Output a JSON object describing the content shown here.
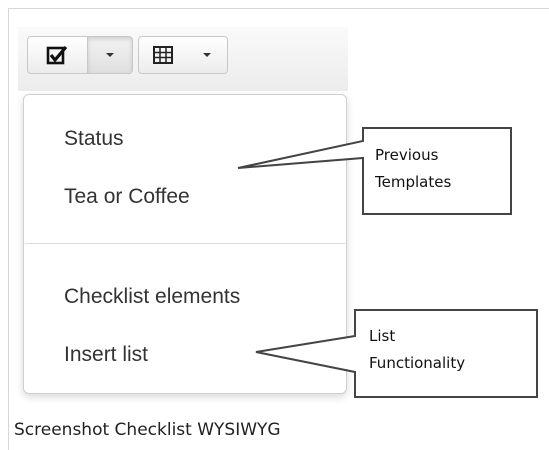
{
  "toolbar": {
    "checklist_button_icon": "checkbox-checked-icon",
    "table_button_icon": "table-grid-icon"
  },
  "menu": {
    "items": [
      {
        "label": "Status"
      },
      {
        "label": "Tea or Coffee"
      },
      {
        "label": "Checklist elements"
      },
      {
        "label": "Insert list"
      }
    ]
  },
  "callouts": {
    "previous_templates": [
      "Previous",
      "Templates"
    ],
    "list_functionality": [
      "List",
      "Functionality"
    ]
  },
  "caption": "Screenshot Checklist WYSIWYG",
  "colors": {
    "menu_text": "#333333",
    "border": "#cfcfcf",
    "callout_border": "#444444"
  }
}
